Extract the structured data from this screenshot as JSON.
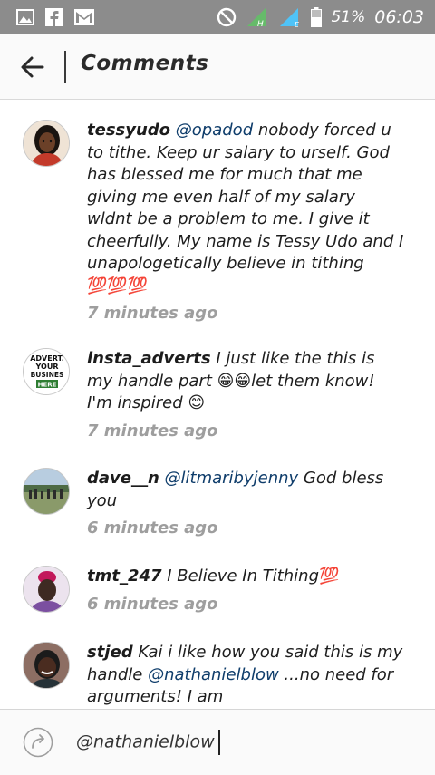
{
  "status_bar": {
    "battery": "51%",
    "time": "06:03",
    "network_label": "H"
  },
  "toolbar": {
    "title": "Comments"
  },
  "comments": [
    {
      "username": "tessyudo",
      "mention": "@opadod",
      "text": "nobody forced u to tithe. Keep ur salary to urself. God has blessed me for much that me giving me  even half of my salary wldnt be a problem to me. I give it cheerfully. My name is Tessy Udo  and I unapologetically believe in tithing",
      "emoji": "💯💯💯",
      "time": "7 minutes ago"
    },
    {
      "username": "insta_adverts",
      "text_a": "I just like the this is my handle part",
      "emoji_a": "😁😁",
      "text_b": "let them know! I'm inspired",
      "emoji_b": "😊",
      "time": "7 minutes ago",
      "avatar_text": [
        "ADVERT.",
        "YOUR",
        "BUSINES",
        "HERE"
      ]
    },
    {
      "username": "dave__n",
      "mention": "@litmaribyjenny",
      "text": "God bless you",
      "time": "6 minutes ago"
    },
    {
      "username": "tmt_247",
      "text": "I Believe In Tithing",
      "emoji": "💯",
      "time": "6 minutes ago"
    },
    {
      "username": "stjed",
      "text_a": "Kai i like how you said this is my handle",
      "mention": "@nathanielblow",
      "text_b": "...no need for arguments! I am"
    }
  ],
  "input": {
    "value": "@nathanielblow"
  },
  "colors": {
    "status_bar": "#8c8c8c",
    "mention": "#0f3d6b",
    "timestamp": "#9e9e9e",
    "signal": "#66bb6a"
  }
}
